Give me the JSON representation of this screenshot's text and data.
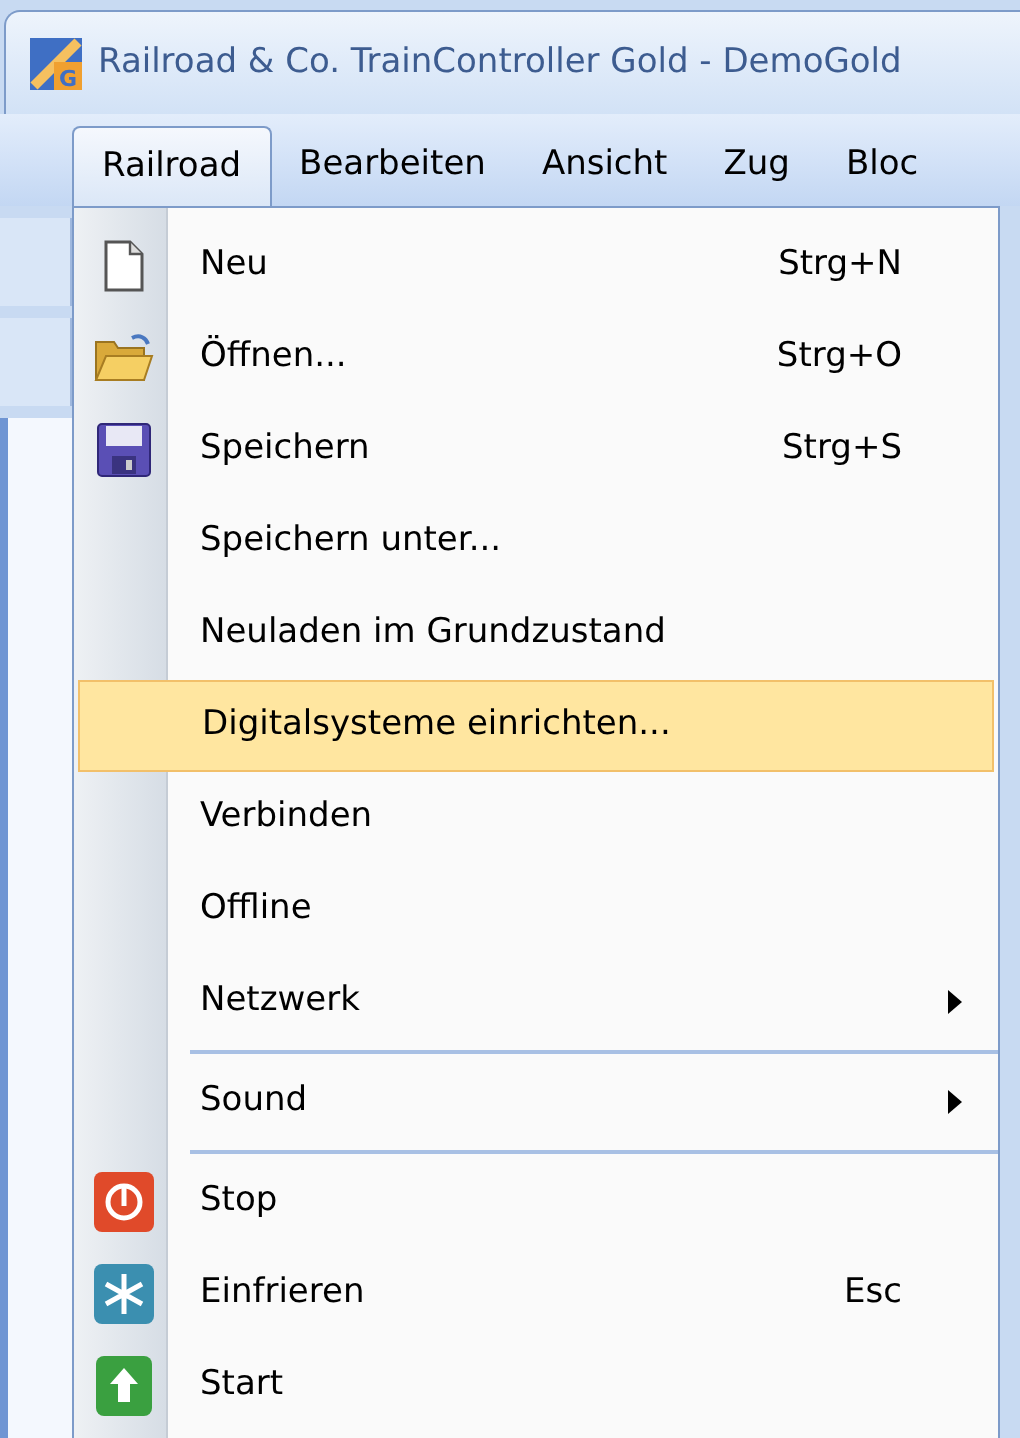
{
  "window": {
    "title": "Railroad & Co. TrainController Gold - DemoGold",
    "logo_letter": "G"
  },
  "menu_bar": [
    {
      "label": "Railroad",
      "selected": true
    },
    {
      "label": "Bearbeiten",
      "selected": false
    },
    {
      "label": "Ansicht",
      "selected": false
    },
    {
      "label": "Zug",
      "selected": false
    },
    {
      "label": "Bloc",
      "selected": false
    }
  ],
  "menu": {
    "items": [
      {
        "kind": "item",
        "label": "Neu",
        "shortcut": "Strg+N",
        "selected": false,
        "submenu": false
      },
      {
        "kind": "item",
        "label": "Öffnen...",
        "shortcut": "Strg+O",
        "selected": false,
        "submenu": false
      },
      {
        "kind": "item",
        "label": "Speichern",
        "shortcut": "Strg+S",
        "selected": false,
        "submenu": false
      },
      {
        "kind": "item",
        "label": "Speichern unter...",
        "selected": false,
        "submenu": false
      },
      {
        "kind": "item",
        "label": "Neuladen im Grundzustand",
        "selected": false,
        "submenu": false
      },
      {
        "kind": "item",
        "label": "Digitalsysteme einrichten...",
        "selected": true,
        "submenu": false
      },
      {
        "kind": "item",
        "label": "Verbinden",
        "selected": false,
        "submenu": false
      },
      {
        "kind": "item",
        "label": "Offline",
        "selected": false,
        "submenu": false
      },
      {
        "kind": "item",
        "label": "Netzwerk",
        "selected": false,
        "submenu": true
      },
      {
        "kind": "separator"
      },
      {
        "kind": "item",
        "label": "Sound",
        "selected": false,
        "submenu": true
      },
      {
        "kind": "separator"
      },
      {
        "kind": "item",
        "label": "Stop",
        "selected": false,
        "submenu": false
      },
      {
        "kind": "item",
        "label": "Einfrieren",
        "shortcut": "Esc",
        "selected": false,
        "submenu": false
      },
      {
        "kind": "item",
        "label": "Start",
        "selected": false,
        "submenu": false
      }
    ]
  }
}
